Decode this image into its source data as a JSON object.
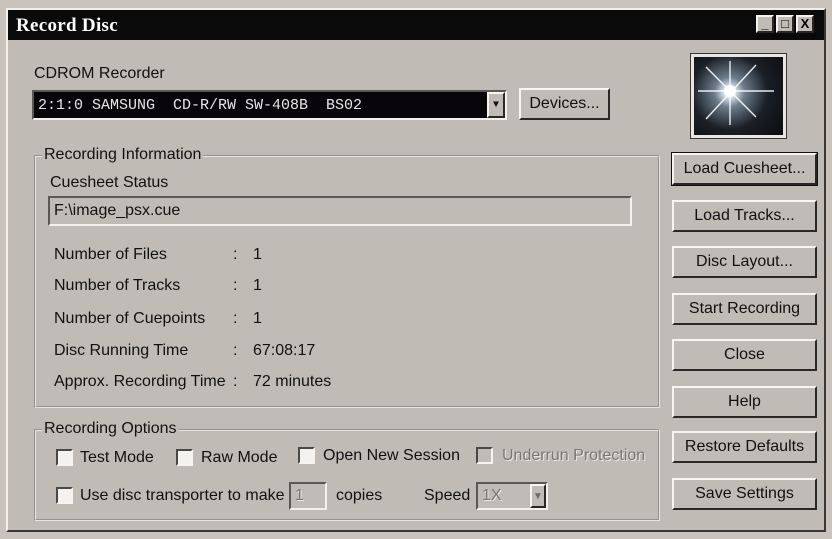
{
  "window": {
    "title": "Record Disc"
  },
  "recorder": {
    "label": "CDROM Recorder",
    "selected": "2:1:0 SAMSUNG  CD-R/RW SW-408B  BS02",
    "devices_label": "Devices..."
  },
  "recording_info": {
    "legend": "Recording Information",
    "cuesheet_status_label": "Cuesheet Status",
    "cuesheet_path": "F:\\image_psx.cue",
    "rows": [
      {
        "label": "Number of Files",
        "sep": ":",
        "value": "1"
      },
      {
        "label": "Number of Tracks",
        "sep": ":",
        "value": "1"
      },
      {
        "label": "Number of Cuepoints",
        "sep": ":",
        "value": "1"
      },
      {
        "label": "Disc Running Time",
        "sep": ":",
        "value": "67:08:17"
      },
      {
        "label": "Approx. Recording Time",
        "sep": ":",
        "value": "72 minutes"
      }
    ]
  },
  "recording_options": {
    "legend": "Recording Options",
    "test_mode": "Test Mode",
    "raw_mode": "Raw Mode",
    "open_new_session": "Open New Session",
    "underrun_protection": "Underrun Protection",
    "disc_transporter": "Use disc transporter to make",
    "copies_value": "1",
    "copies_label": "copies",
    "speed_label": "Speed",
    "speed_value": "1X"
  },
  "buttons": {
    "load_cuesheet": "Load Cuesheet...",
    "load_tracks": "Load Tracks...",
    "disc_layout": "Disc Layout...",
    "start_recording": "Start Recording",
    "close": "Close",
    "help": "Help",
    "restore_defaults": "Restore Defaults",
    "save_settings": "Save Settings"
  },
  "title_buttons": {
    "minimize": "_",
    "maximize": "□",
    "close": "X"
  }
}
